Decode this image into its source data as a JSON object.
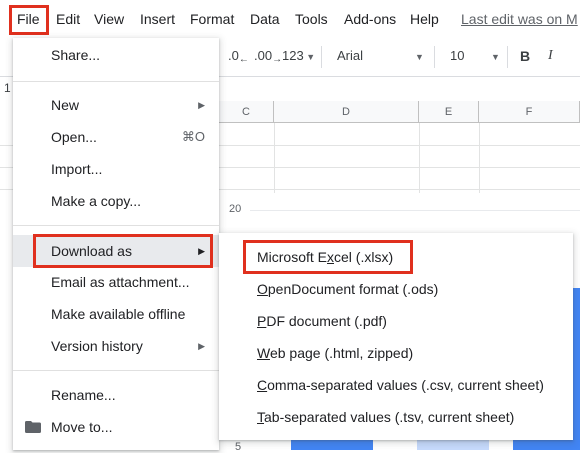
{
  "menubar": {
    "file": "File",
    "edit": "Edit",
    "view": "View",
    "insert": "Insert",
    "format": "Format",
    "data": "Data",
    "tools": "Tools",
    "addons": "Add-ons",
    "help": "Help",
    "last_edit": "Last edit was on M"
  },
  "toolbar": {
    "decimal_decrease": ".0",
    "decimal_increase": ".00",
    "number_format": "123",
    "font": "Arial",
    "font_size": "10",
    "bold": "B",
    "italic": "I"
  },
  "row_number": "1",
  "columns": [
    "C",
    "D",
    "E",
    "F"
  ],
  "chart": {
    "y_labels": [
      "20",
      "5"
    ]
  },
  "file_menu": {
    "share": "Share...",
    "new": "New",
    "open": "Open...",
    "open_shortcut": "⌘O",
    "import": "Import...",
    "make_copy": "Make a copy...",
    "download_as": "Download as",
    "email_attachment": "Email as attachment...",
    "offline": "Make available offline",
    "version_history": "Version history",
    "rename": "Rename...",
    "move_to": "Move to..."
  },
  "download_submenu": [
    {
      "pre": "Microsoft E",
      "u": "x",
      "post": "cel (.xlsx)"
    },
    {
      "pre": "",
      "u": "O",
      "post": "penDocument format (.ods)"
    },
    {
      "pre": "",
      "u": "P",
      "post": "DF document (.pdf)"
    },
    {
      "pre": "",
      "u": "W",
      "post": "eb page (.html, zipped)"
    },
    {
      "pre": "",
      "u": "C",
      "post": "omma-separated values (.csv, current sheet)"
    },
    {
      "pre": "",
      "u": "T",
      "post": "ab-separated values (.tsv, current sheet)"
    }
  ],
  "colors": {
    "highlight": "#e0301e",
    "hover": "#e8eaed",
    "bar_blue": "#4285f4",
    "bar_light": "#c6dafc"
  }
}
